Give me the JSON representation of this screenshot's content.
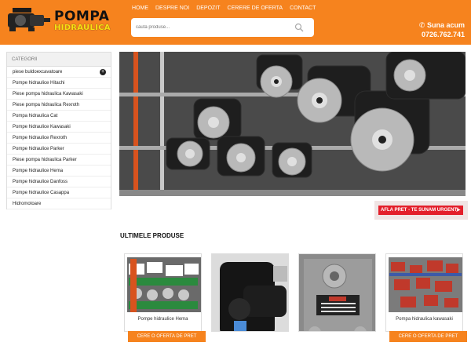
{
  "brand": {
    "line1": "POMPA",
    "line2": "HIDRAULICA"
  },
  "nav": [
    "HOME",
    "DESPRE NOI",
    "DEPOZIT",
    "CERERE DE OFERTA",
    "CONTACT"
  ],
  "search": {
    "placeholder": "cauta produse..."
  },
  "call": {
    "title": "Suna acum",
    "phone": "0726.762.741"
  },
  "sidebar": {
    "title": "CATEGORII",
    "items": [
      "piese buldoexcavatoare",
      "Pompe hidraulice Hitachi",
      "Piese pompa hidraulica Kawasaki",
      "Piese pompa hidraulica Rexroth",
      "Pompa hidraulica Cat",
      "Pompe hidraulice Kawasaki",
      "Pompe hidraulice Rexroth",
      "Pompe hidraulice Parker",
      "Piese pompa hidraulica Parker",
      "Pompe hidraulice Hema",
      "Pompe hidraulice Danfoss",
      "Pompe hidraulice Casappa",
      "Hidromotoare"
    ]
  },
  "cta": {
    "label": "AFLA PRET - TE SUNAM URGENT!"
  },
  "latest": {
    "title": "ULTIMELE PRODUSE",
    "products": [
      {
        "name": "Pompe hidraulice Hema",
        "button": "CERE O OFERTA DE PRET"
      },
      {
        "name": "",
        "button": ""
      },
      {
        "name": "",
        "button": ""
      },
      {
        "name": "Pompa hidraulica kawasaki",
        "button": "CERE O OFERTA DE PRET"
      }
    ]
  },
  "colors": {
    "accent": "#f6831e",
    "cta": "#e31f2b"
  }
}
